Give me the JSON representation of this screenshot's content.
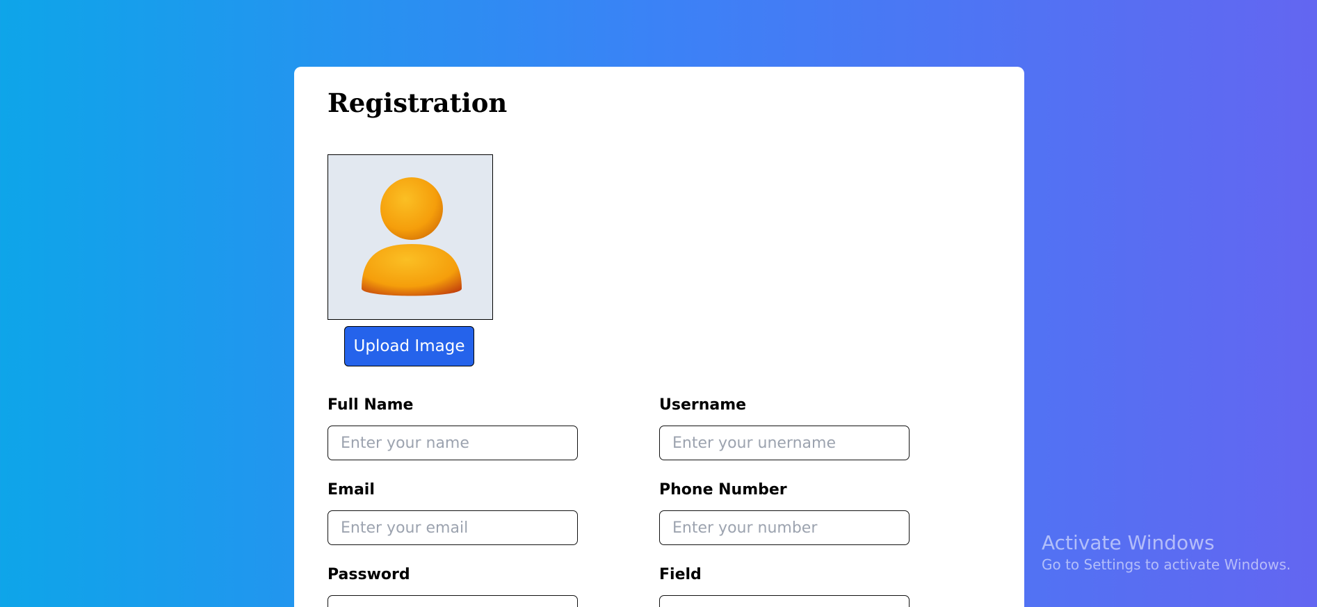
{
  "form": {
    "title": "Registration",
    "upload_label": "Upload Image",
    "fields": {
      "full_name": {
        "label": "Full Name",
        "placeholder": "Enter your name"
      },
      "username": {
        "label": "Username",
        "placeholder": "Enter your unername"
      },
      "email": {
        "label": "Email",
        "placeholder": "Enter your email"
      },
      "phone": {
        "label": "Phone Number",
        "placeholder": "Enter your number"
      },
      "password": {
        "label": "Password",
        "placeholder": ""
      },
      "field": {
        "label": "Field",
        "placeholder": ""
      }
    }
  },
  "avatar": {
    "icon": "user-avatar-icon",
    "color": "#f59e0b"
  },
  "colors": {
    "background_start": "#0ea5e9",
    "background_end": "#6366f1",
    "button": "#2563eb"
  },
  "watermark": {
    "title": "Activate Windows",
    "subtitle": "Go to Settings to activate Windows."
  }
}
